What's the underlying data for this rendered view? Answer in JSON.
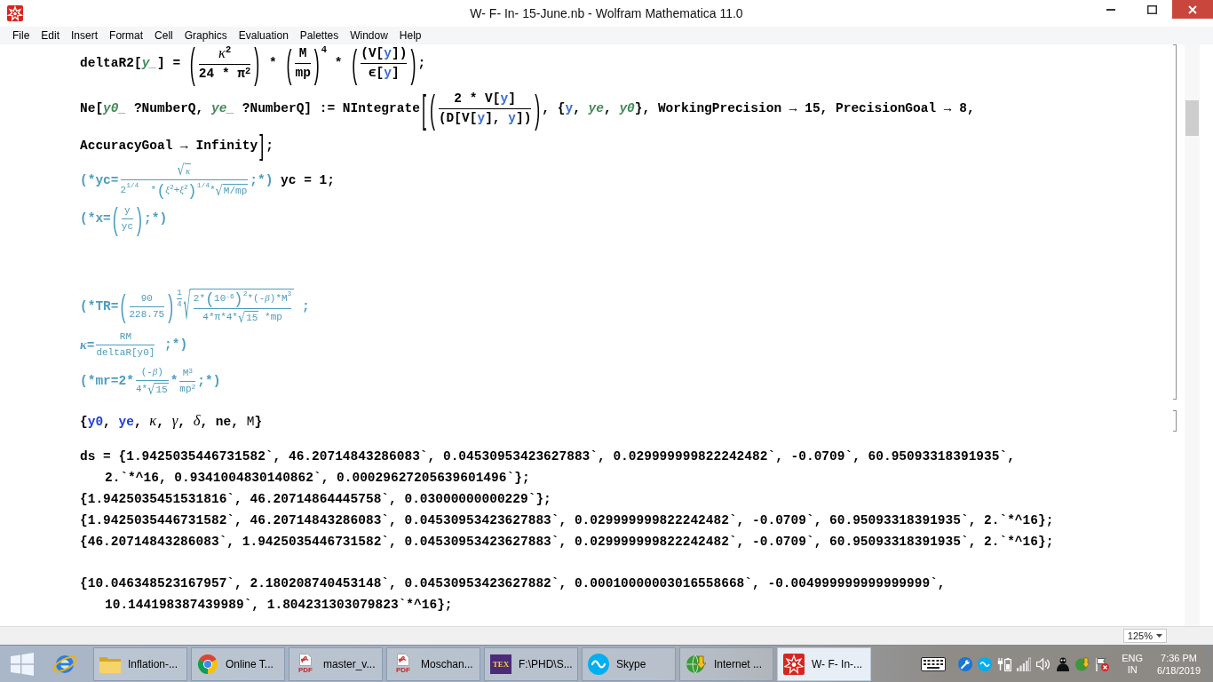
{
  "window": {
    "title": "W- F- In- 15-June.nb - Wolfram Mathematica 11.0"
  },
  "menu": [
    "File",
    "Edit",
    "Insert",
    "Format",
    "Cell",
    "Graphics",
    "Evaluation",
    "Palettes",
    "Window",
    "Help"
  ],
  "notebook": {
    "groups": [
      {
        "bracket": true,
        "cells": [
          {
            "lines": [
              {
                "kind": "start",
                "tokens": [
                  {
                    "kind": "code",
                    "text": "deltaR2["
                  },
                  {
                    "kind": "pattern",
                    "text": "y_"
                  },
                  {
                    "kind": "code",
                    "text": "] = "
                  },
                  {
                    "kind": "fence",
                    "open": "(",
                    "close": ")",
                    "items": [
                      {
                        "kind": "frac",
                        "num": [
                          {
                            "kind": "greek",
                            "text": "κ"
                          },
                          {
                            "kind": "sup",
                            "items": [
                              {
                                "kind": "code",
                                "text": "2"
                              }
                            ]
                          }
                        ],
                        "den": [
                          {
                            "kind": "code",
                            "text": "24 * π"
                          },
                          {
                            "kind": "sup",
                            "items": [
                              {
                                "kind": "code",
                                "text": "2"
                              }
                            ]
                          }
                        ]
                      }
                    ]
                  },
                  {
                    "kind": "code",
                    "text": " * "
                  },
                  {
                    "kind": "fence",
                    "open": "(",
                    "close": ")",
                    "items": [
                      {
                        "kind": "frac",
                        "num": [
                          {
                            "kind": "code",
                            "text": "M"
                          }
                        ],
                        "den": [
                          {
                            "kind": "code",
                            "text": "mp"
                          }
                        ]
                      }
                    ]
                  },
                  {
                    "kind": "sup",
                    "items": [
                      {
                        "kind": "code",
                        "text": "4"
                      }
                    ]
                  },
                  {
                    "kind": "code",
                    "text": " * "
                  },
                  {
                    "kind": "fence",
                    "open": "(",
                    "close": ")",
                    "items": [
                      {
                        "kind": "frac",
                        "num": [
                          {
                            "kind": "code",
                            "text": "(V["
                          },
                          {
                            "kind": "local",
                            "text": "y"
                          },
                          {
                            "kind": "code",
                            "text": "])"
                          }
                        ],
                        "den": [
                          {
                            "kind": "code",
                            "text": "ϵ["
                          },
                          {
                            "kind": "local",
                            "text": "y"
                          },
                          {
                            "kind": "code",
                            "text": "]"
                          }
                        ]
                      }
                    ]
                  },
                  {
                    "kind": "code",
                    "text": ";"
                  }
                ]
              }
            ]
          },
          {
            "lines": [
              {
                "kind": "start",
                "tokens": [
                  {
                    "kind": "code",
                    "text": "Ne["
                  },
                  {
                    "kind": "pattern",
                    "text": "y0_"
                  },
                  {
                    "kind": "code",
                    "text": " ?NumberQ, "
                  },
                  {
                    "kind": "pattern",
                    "text": "ye_"
                  },
                  {
                    "kind": "code",
                    "text": " ?NumberQ] := NIntegrate"
                  },
                  {
                    "kind": "big",
                    "text": "["
                  },
                  {
                    "kind": "fence",
                    "open": "(",
                    "close": ")",
                    "items": [
                      {
                        "kind": "frac",
                        "num": [
                          {
                            "kind": "code",
                            "text": "2 * V["
                          },
                          {
                            "kind": "local",
                            "text": "y"
                          },
                          {
                            "kind": "code",
                            "text": "]"
                          }
                        ],
                        "den": [
                          {
                            "kind": "code",
                            "text": "(D[V["
                          },
                          {
                            "kind": "local",
                            "text": "y"
                          },
                          {
                            "kind": "code",
                            "text": "], "
                          },
                          {
                            "kind": "local",
                            "text": "y"
                          },
                          {
                            "kind": "code",
                            "text": "])"
                          }
                        ]
                      }
                    ]
                  },
                  {
                    "kind": "code",
                    "text": ", {"
                  },
                  {
                    "kind": "local",
                    "text": "y"
                  },
                  {
                    "kind": "code",
                    "text": ", "
                  },
                  {
                    "kind": "pattern",
                    "text": "ye"
                  },
                  {
                    "kind": "code",
                    "text": ", "
                  },
                  {
                    "kind": "pattern",
                    "text": "y0"
                  },
                  {
                    "kind": "code",
                    "text": "}, WorkingPrecision → 15, PrecisionGoal → 8,"
                  }
                ]
              },
              {
                "kind": "continued",
                "tokens": [
                  {
                    "kind": "code",
                    "text": "AccuracyGoal → Infinity"
                  },
                  {
                    "kind": "big",
                    "text": "]"
                  },
                  {
                    "kind": "code",
                    "text": ";"
                  }
                ]
              }
            ]
          },
          {
            "lines": [
              {
                "kind": "start",
                "tokens": [
                  {
                    "kind": "comment",
                    "text": "(*yc="
                  },
                  {
                    "kind": "frac",
                    "num": [
                      {
                        "kind": "sqrt",
                        "sign": "√",
                        "items": [
                          {
                            "kind": "commentsymbol",
                            "text": "κ"
                          }
                        ]
                      }
                    ],
                    "den": [
                      {
                        "kind": "comment",
                        "text": "2"
                      },
                      {
                        "kind": "sup",
                        "items": [
                          {
                            "kind": "comment",
                            "text": "1/4"
                          }
                        ]
                      },
                      {
                        "kind": "comment",
                        "text": "  *"
                      },
                      {
                        "kind": "fence",
                        "open": "(",
                        "close": ")",
                        "items": [
                          {
                            "kind": "commentsymbol",
                            "text": "ξ"
                          },
                          {
                            "kind": "sup",
                            "items": [
                              {
                                "kind": "comment",
                                "text": "2"
                              }
                            ]
                          },
                          {
                            "kind": "comment",
                            "text": "+"
                          },
                          {
                            "kind": "commentsymbol",
                            "text": "ξ"
                          },
                          {
                            "kind": "sup",
                            "items": [
                              {
                                "kind": "comment",
                                "text": "2"
                              }
                            ]
                          }
                        ]
                      },
                      {
                        "kind": "sup",
                        "items": [
                          {
                            "kind": "comment",
                            "text": "1/4"
                          }
                        ]
                      },
                      {
                        "kind": "comment",
                        "text": "*"
                      },
                      {
                        "kind": "sqrt",
                        "sign": "√",
                        "items": [
                          {
                            "kind": "comment",
                            "text": "M/mp"
                          }
                        ]
                      }
                    ]
                  },
                  {
                    "kind": "comment",
                    "text": ";*)"
                  },
                  {
                    "kind": "code",
                    "text": " yc = 1;"
                  }
                ]
              },
              {
                "kind": "start",
                "tokens": [
                  {
                    "kind": "comment",
                    "text": "(*x="
                  },
                  {
                    "kind": "fence",
                    "open": "(",
                    "close": ")",
                    "items": [
                      {
                        "kind": "frac",
                        "num": [
                          {
                            "kind": "comment",
                            "text": "y"
                          }
                        ],
                        "den": [
                          {
                            "kind": "comment",
                            "text": "yc"
                          }
                        ]
                      }
                    ]
                  },
                  {
                    "kind": "comment",
                    "text": ";*)"
                  }
                ]
              }
            ]
          },
          {
            "lines": [
              {
                "kind": "start",
                "tokens": [
                  {
                    "kind": "comment",
                    "text": "(*TR="
                  },
                  {
                    "kind": "fence",
                    "open": "(",
                    "close": ")",
                    "items": [
                      {
                        "kind": "frac",
                        "num": [
                          {
                            "kind": "comment",
                            "text": "90"
                          }
                        ],
                        "den": [
                          {
                            "kind": "comment",
                            "text": "228.75"
                          }
                        ]
                      }
                    ]
                  },
                  {
                    "kind": "sup",
                    "items": [
                      {
                        "kind": "frac",
                        "num": [
                          {
                            "kind": "comment",
                            "text": "1"
                          }
                        ],
                        "den": [
                          {
                            "kind": "comment",
                            "text": "4"
                          }
                        ]
                      }
                    ]
                  },
                  {
                    "kind": "sqrt",
                    "sign": "√",
                    "items": [
                      {
                        "kind": "frac",
                        "num": [
                          {
                            "kind": "comment",
                            "text": "2*"
                          },
                          {
                            "kind": "fence",
                            "open": "(",
                            "close": ")",
                            "items": [
                              {
                                "kind": "comment",
                                "text": "10"
                              },
                              {
                                "kind": "sup",
                                "items": [
                                  {
                                    "kind": "comment",
                                    "text": "-6"
                                  }
                                ]
                              }
                            ]
                          },
                          {
                            "kind": "sup",
                            "items": [
                              {
                                "kind": "comment",
                                "text": "2"
                              }
                            ]
                          },
                          {
                            "kind": "comment",
                            "text": "*(-"
                          },
                          {
                            "kind": "commentsymbol",
                            "text": "β"
                          },
                          {
                            "kind": "comment",
                            "text": ")*M"
                          },
                          {
                            "kind": "sup",
                            "items": [
                              {
                                "kind": "comment",
                                "text": "3"
                              }
                            ]
                          }
                        ],
                        "den": [
                          {
                            "kind": "comment",
                            "text": "4*π*4*"
                          },
                          {
                            "kind": "sqrt",
                            "sign": "√",
                            "items": [
                              {
                                "kind": "comment",
                                "text": "15"
                              }
                            ]
                          },
                          {
                            "kind": "comment",
                            "text": " *mp"
                          }
                        ]
                      }
                    ]
                  },
                  {
                    "kind": "comment",
                    "text": " ;"
                  }
                ]
              },
              {
                "kind": "start",
                "tokens": [
                  {
                    "kind": "commentsymbol",
                    "text": "κ"
                  },
                  {
                    "kind": "comment",
                    "text": "="
                  },
                  {
                    "kind": "frac",
                    "num": [
                      {
                        "kind": "comment",
                        "text": "RM"
                      }
                    ],
                    "den": [
                      {
                        "kind": "comment",
                        "text": "deltaR[y0]"
                      }
                    ]
                  },
                  {
                    "kind": "comment",
                    "text": " ;*)"
                  }
                ]
              },
              {
                "kind": "start",
                "tokens": [
                  {
                    "kind": "comment",
                    "text": "(*mr=2*"
                  },
                  {
                    "kind": "frac",
                    "num": [
                      {
                        "kind": "comment",
                        "text": "(-"
                      },
                      {
                        "kind": "commentsymbol",
                        "text": "β"
                      },
                      {
                        "kind": "comment",
                        "text": ")"
                      }
                    ],
                    "den": [
                      {
                        "kind": "comment",
                        "text": "4*"
                      },
                      {
                        "kind": "sqrt",
                        "sign": "√",
                        "items": [
                          {
                            "kind": "comment",
                            "text": "15"
                          }
                        ]
                      }
                    ]
                  },
                  {
                    "kind": "comment",
                    "text": "*"
                  },
                  {
                    "kind": "frac",
                    "num": [
                      {
                        "kind": "comment",
                        "text": "M"
                      },
                      {
                        "kind": "sup",
                        "items": [
                          {
                            "kind": "comment",
                            "text": "3"
                          }
                        ]
                      }
                    ],
                    "den": [
                      {
                        "kind": "comment",
                        "text": "mp"
                      },
                      {
                        "kind": "sup",
                        "items": [
                          {
                            "kind": "comment",
                            "text": "2"
                          }
                        ]
                      }
                    ]
                  },
                  {
                    "kind": "comment",
                    "text": ";*)"
                  }
                ]
              }
            ]
          }
        ]
      },
      {
        "bracket": true,
        "cells": [
          {
            "lines": [
              {
                "kind": "start",
                "tokens": [
                  {
                    "kind": "code",
                    "text": "{"
                  },
                  {
                    "kind": "symbol",
                    "text": "y0"
                  },
                  {
                    "kind": "code",
                    "text": ", "
                  },
                  {
                    "kind": "symbol",
                    "text": "ye"
                  },
                  {
                    "kind": "code",
                    "text": ", "
                  },
                  {
                    "kind": "greek",
                    "text": "κ"
                  },
                  {
                    "kind": "code",
                    "text": ", "
                  },
                  {
                    "kind": "greek",
                    "text": "γ"
                  },
                  {
                    "kind": "code",
                    "text": ", "
                  },
                  {
                    "kind": "greek",
                    "text": "δ"
                  },
                  {
                    "kind": "code",
                    "text": ", ne, "
                  },
                  {
                    "kind": "plain",
                    "text": "M"
                  },
                  {
                    "kind": "code",
                    "text": "}"
                  }
                ]
              }
            ]
          }
        ]
      },
      {
        "bracket": false,
        "cells": [
          {
            "lines": [
              {
                "kind": "start",
                "tokens": [
                  {
                    "kind": "code",
                    "text": "ds = {1.9425035446731582`, 46.20714843286083`, 0.04530953423627883`, 0.029999999822242482`, -0.0709`, 60.95093318391935`,"
                  }
                ]
              },
              {
                "kind": "continued",
                "tokens": [
                  {
                    "kind": "code",
                    "text": "2.`*^16, 0.9341004830140862`, 0.00029627205639601496`};"
                  }
                ]
              }
            ]
          },
          {
            "lines": [
              {
                "kind": "start",
                "tokens": [
                  {
                    "kind": "code",
                    "text": "{1.9425035451531816`, 46.20714864445758`, 0.03000000000229`};"
                  }
                ]
              }
            ]
          },
          {
            "lines": [
              {
                "kind": "start",
                "tokens": [
                  {
                    "kind": "code",
                    "text": "{1.9425035446731582`, 46.20714843286083`, 0.04530953423627883`, 0.029999999822242482`, -0.0709`, 60.95093318391935`, 2.`*^16};"
                  }
                ]
              }
            ]
          },
          {
            "lines": [
              {
                "kind": "start",
                "tokens": [
                  {
                    "kind": "code",
                    "text": "{46.20714843286083`, 1.9425035446731582`, 0.04530953423627883`, 0.029999999822242482`, -0.0709`, 60.95093318391935`, 2.`*^16};"
                  }
                ]
              }
            ]
          }
        ]
      },
      {
        "bracket": false,
        "cells": [
          {
            "lines": [
              {
                "kind": "start",
                "tokens": [
                  {
                    "kind": "code",
                    "text": "{10.046348523167957`, 2.180208740453148`, 0.04530953423627882`, 0.00010000003016558668`, -0.004999999999999999`,"
                  }
                ]
              },
              {
                "kind": "continued",
                "tokens": [
                  {
                    "kind": "code",
                    "text": "10.144198387439989`, 1.804231303079823`*^16};"
                  }
                ]
              }
            ]
          }
        ]
      }
    ]
  },
  "status_bar": {
    "zoom": "125%"
  },
  "taskbar": {
    "buttons": [
      {
        "label": "Inflation-...",
        "selected": false
      },
      {
        "label": "Online T...",
        "selected": false
      },
      {
        "label": "master_v...",
        "badge": "PDF",
        "selected": false
      },
      {
        "label": "Moschan...",
        "badge": "PDF",
        "selected": false
      },
      {
        "label": "F:\\PHD\\S...",
        "badge": "TEX",
        "selected": false
      },
      {
        "label": "Skype",
        "selected": false
      },
      {
        "label": "Internet ...",
        "selected": false
      },
      {
        "label": "W- F- In-...",
        "selected": true
      }
    ],
    "language": [
      "ENG",
      "IN"
    ],
    "clock": {
      "time": "7:36 PM",
      "date": "6/18/2019"
    }
  }
}
